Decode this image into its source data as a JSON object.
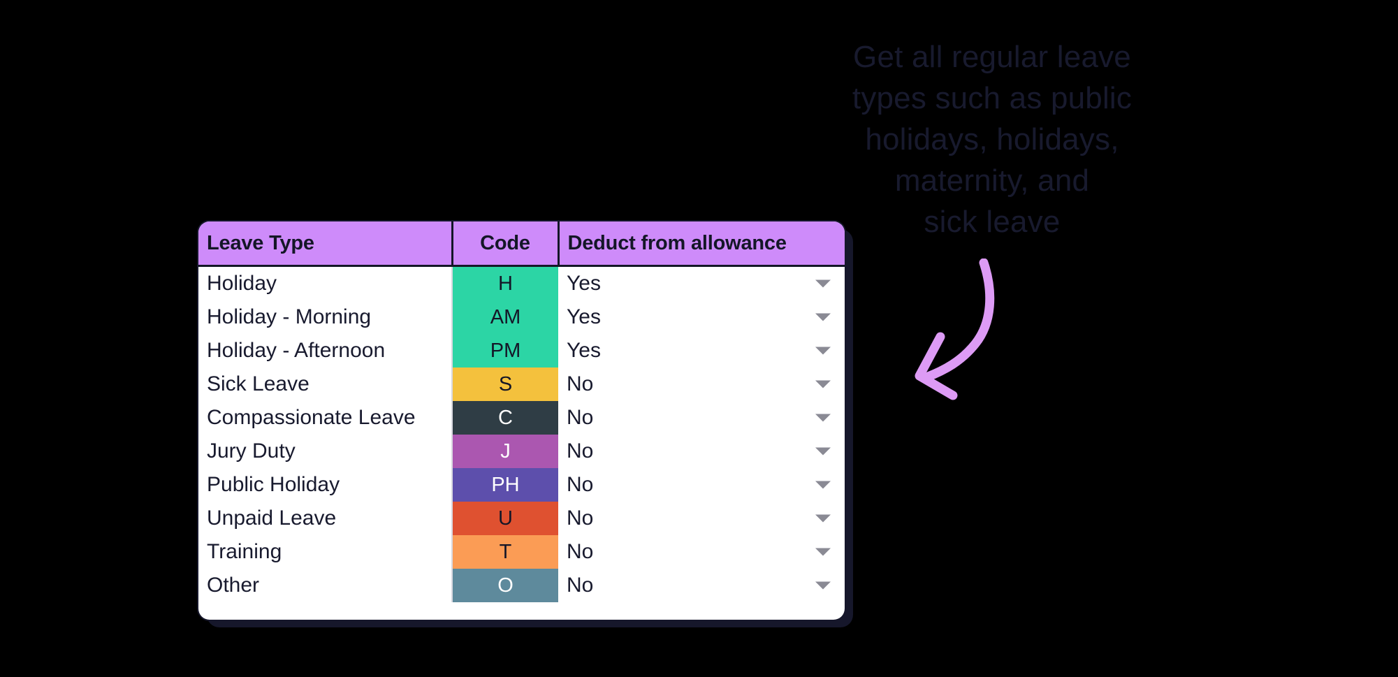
{
  "annotation": {
    "lines": [
      "Get all regular leave",
      "types such as public",
      "holidays, holidays,",
      "maternity, and",
      "sick leave"
    ],
    "text_color": "#181a2e",
    "arrow_color": "#dd9bf5",
    "arrow_icon": "curved-arrow-left-icon"
  },
  "table": {
    "columns": [
      {
        "key": "leave_type",
        "label": "Leave Type"
      },
      {
        "key": "code",
        "label": "Code"
      },
      {
        "key": "deduct",
        "label": "Deduct from allowance"
      }
    ],
    "header_bg": "#ce8bfa",
    "header_text_color": "#141627",
    "card_bg": "#ffffff",
    "shadow_color": "#16172b",
    "rows": [
      {
        "leave_type": "Holiday",
        "code": "H",
        "code_bg": "#2cd5a5",
        "code_fg": "#141627",
        "deduct": "Yes",
        "dropdown_icon": "chevron-down-icon"
      },
      {
        "leave_type": "Holiday - Morning",
        "code": "AM",
        "code_bg": "#2cd5a5",
        "code_fg": "#141627",
        "deduct": "Yes",
        "dropdown_icon": "chevron-down-icon"
      },
      {
        "leave_type": "Holiday - Afternoon",
        "code": "PM",
        "code_bg": "#2cd5a5",
        "code_fg": "#141627",
        "deduct": "Yes",
        "dropdown_icon": "chevron-down-icon"
      },
      {
        "leave_type": "Sick Leave",
        "code": "S",
        "code_bg": "#f4c13d",
        "code_fg": "#141627",
        "deduct": "No",
        "dropdown_icon": "chevron-down-icon"
      },
      {
        "leave_type": "Compassionate Leave",
        "code": "C",
        "code_bg": "#2f3d45",
        "code_fg": "#ffffff",
        "deduct": "No",
        "dropdown_icon": "chevron-down-icon"
      },
      {
        "leave_type": "Jury Duty",
        "code": "J",
        "code_bg": "#ab57b0",
        "code_fg": "#ffffff",
        "deduct": "No",
        "dropdown_icon": "chevron-down-icon"
      },
      {
        "leave_type": "Public Holiday",
        "code": "PH",
        "code_bg": "#5d4fac",
        "code_fg": "#ffffff",
        "deduct": "No",
        "dropdown_icon": "chevron-down-icon"
      },
      {
        "leave_type": "Unpaid Leave",
        "code": "U",
        "code_bg": "#df5130",
        "code_fg": "#141627",
        "deduct": "No",
        "dropdown_icon": "chevron-down-icon"
      },
      {
        "leave_type": "Training",
        "code": "T",
        "code_bg": "#fb9c55",
        "code_fg": "#141627",
        "deduct": "No",
        "dropdown_icon": "chevron-down-icon"
      },
      {
        "leave_type": "Other",
        "code": "O",
        "code_bg": "#5e8a9c",
        "code_fg": "#ffffff",
        "deduct": "No",
        "dropdown_icon": "chevron-down-icon"
      }
    ]
  }
}
